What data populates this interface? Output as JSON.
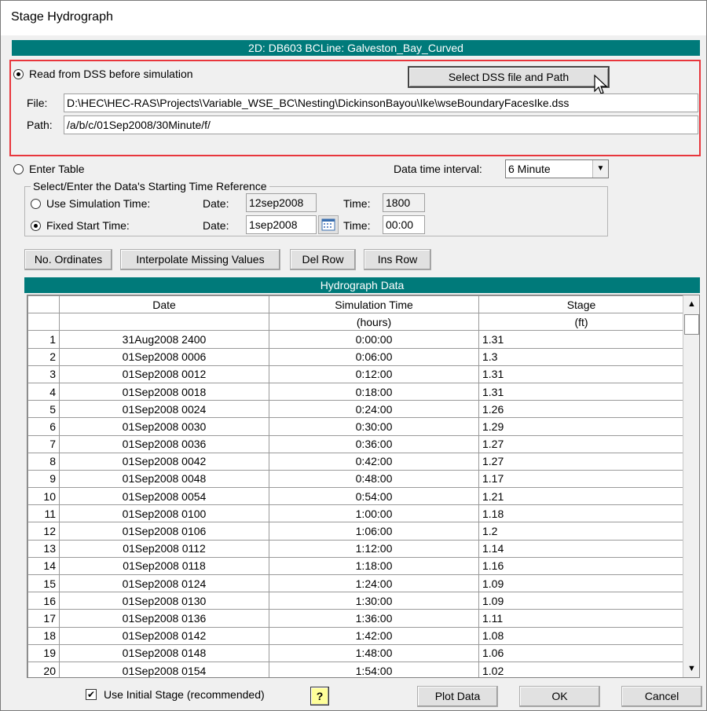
{
  "window": {
    "title": "Stage Hydrograph"
  },
  "boundary": {
    "header": "2D: DB603 BCLine: Galveston_Bay_Curved"
  },
  "dss": {
    "radio_label": "Read from DSS before simulation",
    "select_button": "Select DSS file and Path",
    "file_label": "File:",
    "file_value": "D:\\HEC\\HEC-RAS\\Projects\\Variable_WSE_BC\\Nesting\\DickinsonBayou\\Ike\\wseBoundaryFacesIke.dss",
    "path_label": "Path:",
    "path_value": "/a/b/c/01Sep2008/30Minute/f/"
  },
  "table_entry": {
    "radio_label": "Enter Table",
    "interval_label": "Data time interval:",
    "interval_value": "6 Minute"
  },
  "time_ref": {
    "group_label": "Select/Enter the Data's Starting Time Reference",
    "sim_label": "Use Simulation Time:",
    "sim_date_label": "Date:",
    "sim_date": "12sep2008",
    "sim_time_label": "Time:",
    "sim_time": "1800",
    "fixed_label": "Fixed Start Time:",
    "fixed_date_label": "Date:",
    "fixed_date": "1sep2008",
    "fixed_time_label": "Time:",
    "fixed_time": "00:00"
  },
  "toolbar": {
    "ordinates": "No. Ordinates",
    "interpolate": "Interpolate Missing Values",
    "del_row": "Del Row",
    "ins_row": "Ins Row"
  },
  "grid": {
    "header": "Hydrograph Data",
    "columns": [
      "Date",
      "Simulation Time",
      "Stage"
    ],
    "units": [
      "",
      "(hours)",
      "(ft)"
    ],
    "rows": [
      [
        "1",
        "31Aug2008 2400",
        "0:00:00",
        "1.31"
      ],
      [
        "2",
        "01Sep2008 0006",
        "0:06:00",
        "1.3"
      ],
      [
        "3",
        "01Sep2008 0012",
        "0:12:00",
        "1.31"
      ],
      [
        "4",
        "01Sep2008 0018",
        "0:18:00",
        "1.31"
      ],
      [
        "5",
        "01Sep2008 0024",
        "0:24:00",
        "1.26"
      ],
      [
        "6",
        "01Sep2008 0030",
        "0:30:00",
        "1.29"
      ],
      [
        "7",
        "01Sep2008 0036",
        "0:36:00",
        "1.27"
      ],
      [
        "8",
        "01Sep2008 0042",
        "0:42:00",
        "1.27"
      ],
      [
        "9",
        "01Sep2008 0048",
        "0:48:00",
        "1.17"
      ],
      [
        "10",
        "01Sep2008 0054",
        "0:54:00",
        "1.21"
      ],
      [
        "11",
        "01Sep2008 0100",
        "1:00:00",
        "1.18"
      ],
      [
        "12",
        "01Sep2008 0106",
        "1:06:00",
        "1.2"
      ],
      [
        "13",
        "01Sep2008 0112",
        "1:12:00",
        "1.14"
      ],
      [
        "14",
        "01Sep2008 0118",
        "1:18:00",
        "1.16"
      ],
      [
        "15",
        "01Sep2008 0124",
        "1:24:00",
        "1.09"
      ],
      [
        "16",
        "01Sep2008 0130",
        "1:30:00",
        "1.09"
      ],
      [
        "17",
        "01Sep2008 0136",
        "1:36:00",
        "1.11"
      ],
      [
        "18",
        "01Sep2008 0142",
        "1:42:00",
        "1.08"
      ],
      [
        "19",
        "01Sep2008 0148",
        "1:48:00",
        "1.06"
      ],
      [
        "20",
        "01Sep2008 0154",
        "1:54:00",
        "1.02"
      ]
    ]
  },
  "footer": {
    "checkbox_label": "Use Initial Stage (recommended)",
    "help": "?",
    "plot": "Plot Data",
    "ok": "OK",
    "cancel": "Cancel"
  }
}
